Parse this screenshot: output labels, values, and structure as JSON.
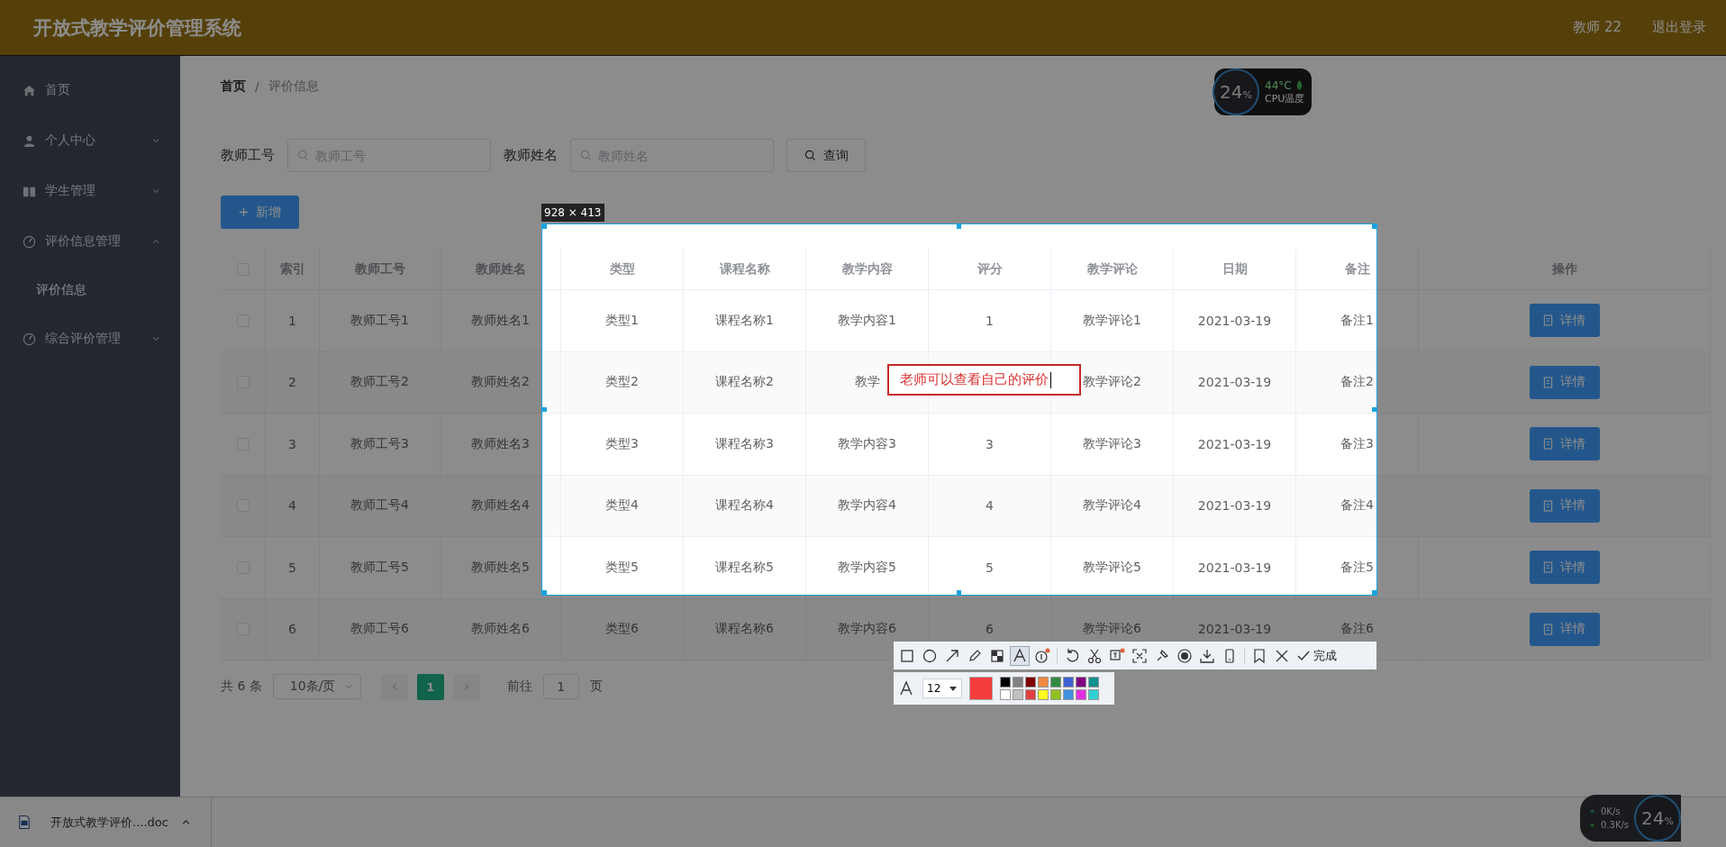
{
  "header": {
    "title": "开放式教学评价管理系统",
    "user": "教师 22",
    "logout": "退出登录"
  },
  "sidebar": {
    "items": [
      {
        "label": "首页",
        "selected": false
      },
      {
        "label": "个人中心",
        "selected": false,
        "expanded": false
      },
      {
        "label": "学生管理",
        "selected": false,
        "expanded": false
      },
      {
        "label": "评价信息管理",
        "selected": false,
        "expanded": true,
        "children": [
          {
            "label": "评价信息",
            "selected": true
          }
        ]
      },
      {
        "label": "综合评价管理",
        "selected": false,
        "expanded": false
      }
    ]
  },
  "breadcrumb": {
    "items": [
      "首页",
      "评价信息"
    ],
    "separator": "/"
  },
  "search": {
    "fields": [
      {
        "label": "教师工号",
        "placeholder": "教师工号"
      },
      {
        "label": "教师姓名",
        "placeholder": "教师姓名"
      }
    ],
    "button": "查询"
  },
  "add_button": "新增",
  "table": {
    "header_checked": false,
    "columns": [
      "索引",
      "教师工号",
      "教师姓名",
      "类型",
      "课程名称",
      "教学内容",
      "评分",
      "教学评论",
      "日期",
      "备注",
      "操作"
    ],
    "rows": [
      {
        "checked": false,
        "cells": [
          "1",
          "教师工号1",
          "教师姓名1",
          "类型1",
          "课程名称1",
          "教学内容1",
          "1",
          "教学评论1",
          "2021-03-19",
          "备注1"
        ],
        "action": "详情"
      },
      {
        "checked": false,
        "cells": [
          "2",
          "教师工号2",
          "教师姓名2",
          "类型2",
          "课程名称2",
          "教学",
          null,
          "教学评论2",
          "2021-03-19",
          "备注2"
        ],
        "action": "详情"
      },
      {
        "checked": false,
        "cells": [
          "3",
          "教师工号3",
          "教师姓名3",
          "类型3",
          "课程名称3",
          "教学内容3",
          "3",
          "教学评论3",
          "2021-03-19",
          "备注3"
        ],
        "action": "详情"
      },
      {
        "checked": false,
        "cells": [
          "4",
          "教师工号4",
          "教师姓名4",
          "类型4",
          "课程名称4",
          "教学内容4",
          "4",
          "教学评论4",
          "2021-03-19",
          "备注4"
        ],
        "action": "详情"
      },
      {
        "checked": false,
        "cells": [
          "5",
          "教师工号5",
          "教师姓名5",
          "类型5",
          "课程名称5",
          "教学内容5",
          "5",
          "教学评论5",
          "2021-03-19",
          "备注5"
        ],
        "action": "详情"
      },
      {
        "checked": false,
        "cells": [
          "6",
          "教师工号6",
          "教师姓名6",
          "类型6",
          "课程名称6",
          "教学内容6",
          "6",
          "教学评论6",
          "2021-03-19",
          "备注6"
        ],
        "action": "详情"
      }
    ]
  },
  "pagination": {
    "total": "共 6 条",
    "page_size": "10条/页",
    "pages": [
      {
        "label": "1",
        "selected": true
      }
    ],
    "goto_label": "前往",
    "goto_value": "1",
    "page_unit": "页"
  },
  "download_bar": {
    "file": "开放式教学评价....doc"
  },
  "cpu_widget": {
    "load": "24",
    "unit": "%",
    "temp": "44°C",
    "label": "CPU温度"
  },
  "net_widget": {
    "up": "0K/s",
    "down": "0.3K/s",
    "load": "24",
    "unit": "%"
  },
  "capture": {
    "size": "928 × 413",
    "annotation": "老师可以查看自己的评价",
    "tools": [
      {
        "selected": false
      },
      {
        "selected": false
      },
      {
        "selected": false
      },
      {
        "selected": false
      },
      {
        "selected": false
      },
      {
        "selected": true
      },
      {
        "selected": false
      },
      {
        "selected": false
      },
      {
        "selected": false
      },
      {
        "selected": false
      },
      {
        "selected": false
      },
      {
        "selected": false
      },
      {
        "selected": false
      },
      {
        "selected": false
      },
      {
        "selected": false
      },
      {
        "selected": false
      }
    ],
    "done": "完成",
    "font_size": "12",
    "current_swatch": {
      "color": "#f53c3c"
    },
    "palette": [
      {
        "color": "#000000"
      },
      {
        "color": "#808080"
      },
      {
        "color": "#800000"
      },
      {
        "color": "#f08a40"
      },
      {
        "color": "#308a40"
      },
      {
        "color": "#4060d0"
      },
      {
        "color": "#800080"
      },
      {
        "color": "#109090"
      },
      {
        "color": "#ffffff"
      },
      {
        "color": "#c0c0c0"
      },
      {
        "color": "#e04040"
      },
      {
        "color": "#ffff20"
      },
      {
        "color": "#90c020"
      },
      {
        "color": "#4090e0"
      },
      {
        "color": "#e030e0"
      },
      {
        "color": "#30d0d0"
      }
    ]
  }
}
